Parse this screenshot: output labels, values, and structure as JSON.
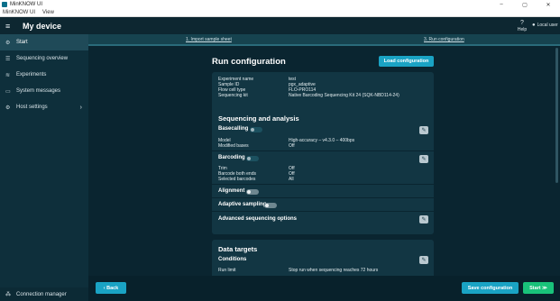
{
  "window": {
    "title": "MinKNOW UI",
    "controls": [
      "–",
      "▢",
      "✕"
    ]
  },
  "menu": [
    "MinKNOW UI",
    "View"
  ],
  "header": {
    "title": "My device",
    "help_label": "Help",
    "user_label": "Local user"
  },
  "sidebar": {
    "items": [
      {
        "label": "Start",
        "icon": "gear-icon",
        "glyph": "⚙",
        "active": true
      },
      {
        "label": "Sequencing overview",
        "icon": "list-icon",
        "glyph": "☰",
        "active": false
      },
      {
        "label": "Experiments",
        "icon": "chart-icon",
        "glyph": "≋",
        "active": false
      },
      {
        "label": "System messages",
        "icon": "message-icon",
        "glyph": "▭",
        "active": false
      },
      {
        "label": "Host settings",
        "icon": "settings-icon",
        "glyph": "⚙",
        "active": false,
        "chevron": "›"
      }
    ],
    "connection_manager": {
      "label": "Connection manager",
      "glyph": "⁂"
    }
  },
  "steps": [
    "1. Import sample sheet",
    "3. Run configuration"
  ],
  "page": {
    "title": "Run configuration",
    "load_button": "Load configuration",
    "summary": {
      "experiment_name_label": "Experiment name",
      "experiment_name": "test",
      "sample_id_label": "Sample ID",
      "sample_id": "pgx_adaptive",
      "flow_cell_label": "Flow cell type",
      "flow_cell": "FLO-PRO114",
      "kit_label": "Sequencing kit",
      "kit": "Native Barcoding Sequencing Kit 24 (SQK-NBD114-24)"
    },
    "seq": {
      "title": "Sequencing and analysis",
      "basecalling": "Basecalling",
      "model_label": "Model",
      "model": "High-accuracy – v4.3.0 – 400bps",
      "modified_label": "Modified bases",
      "modified": "Off",
      "barcoding": "Barcoding",
      "trim_label": "Trim",
      "trim": "Off",
      "both_ends_label": "Barcode both ends",
      "both_ends": "Off",
      "selected_label": "Selected barcodes",
      "selected": "All",
      "alignment": "Alignment",
      "adaptive": "Adaptive sampling",
      "advanced": "Advanced sequencing options"
    },
    "targets": {
      "title": "Data targets",
      "conditions": "Conditions",
      "run_limit_label": "Run limit",
      "run_limit": "Stop run when sequencing reaches 72 hours"
    }
  },
  "footer": {
    "back": "‹ Back",
    "save": "Save configuration",
    "start": "Start ≫"
  },
  "colors": {
    "accent": "#1aa3c4",
    "start": "#19c27a",
    "sidebar": "#0e2f3b",
    "card": "#123643"
  }
}
